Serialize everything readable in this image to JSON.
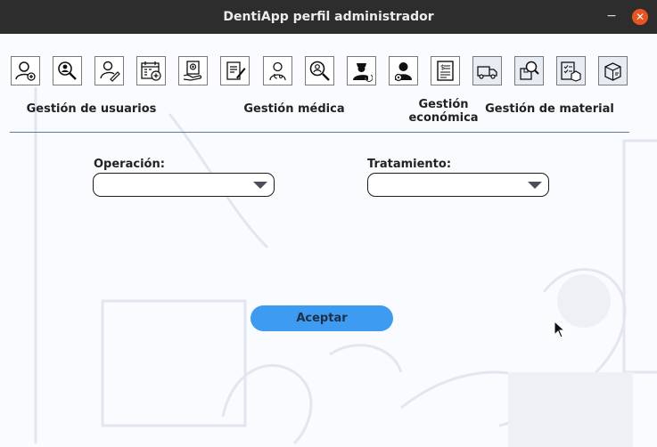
{
  "window": {
    "title": "DentiApp perfil administrador",
    "minimize_glyph": "−",
    "close_glyph": "✕"
  },
  "toolbar": {
    "icons": [
      {
        "name": "add-user-icon",
        "group": "Gestión de usuarios"
      },
      {
        "name": "search-user-icon",
        "group": "Gestión de usuarios"
      },
      {
        "name": "edit-user-icon",
        "group": "Gestión de usuarios"
      },
      {
        "name": "add-appointment-calendar-icon",
        "group": "Gestión de usuarios"
      },
      {
        "name": "medical-register-icon",
        "group": "Gestión médica"
      },
      {
        "name": "medical-record-edit-icon",
        "group": "Gestión médica"
      },
      {
        "name": "doctor-icon",
        "group": "Gestión médica"
      },
      {
        "name": "search-medical-icon",
        "group": "Gestión médica"
      },
      {
        "name": "nurse-refresh-icon",
        "group": "Gestión médica"
      },
      {
        "name": "patient-settings-icon",
        "group": "Gestión médica"
      },
      {
        "name": "invoice-icon",
        "group": "Gestión económica"
      },
      {
        "name": "delivery-truck-icon",
        "group": "Gestión de material"
      },
      {
        "name": "search-package-icon",
        "group": "Gestión de material"
      },
      {
        "name": "inventory-checklist-icon",
        "group": "Gestión de material"
      },
      {
        "name": "package-box-icon",
        "group": "Gestión de material"
      }
    ]
  },
  "sections": {
    "usuarios": "Gestión de usuarios",
    "medica": "Gestión médica",
    "economica_line1": "Gestión",
    "economica_line2": "económica",
    "material": "Gestión de material"
  },
  "form": {
    "operacion_label": "Operación:",
    "operacion_value": "",
    "tratamiento_label": "Tratamiento:",
    "tratamiento_value": "",
    "accept_label": "Aceptar"
  },
  "colors": {
    "titlebar": "#2d2d2d",
    "close_button": "#e95420",
    "accept_button": "#3d9cf2",
    "divider": "#5f7a98"
  }
}
